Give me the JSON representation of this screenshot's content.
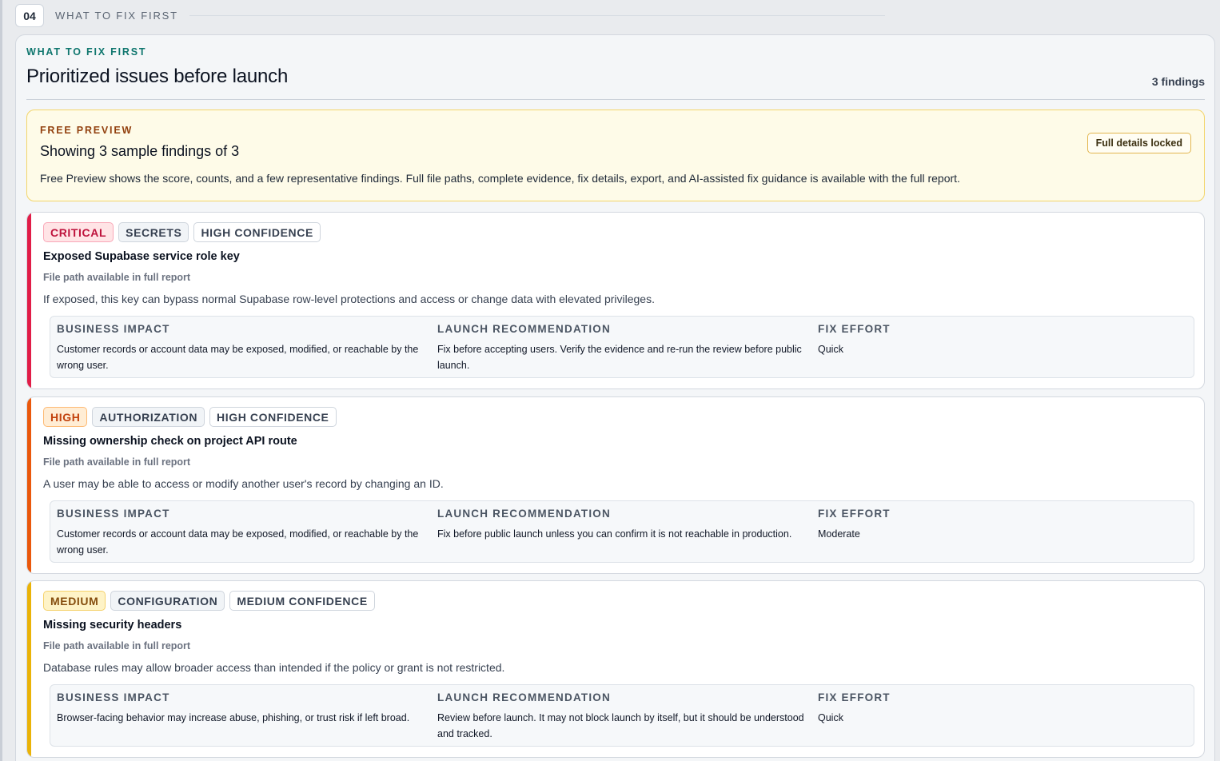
{
  "section": {
    "number": "04",
    "label": "WHAT TO FIX FIRST"
  },
  "panel": {
    "eyebrow": "WHAT TO FIX FIRST",
    "title": "Prioritized issues before launch",
    "count": "3 findings"
  },
  "preview": {
    "eyebrow": "FREE PREVIEW",
    "title": "Showing 3 sample findings of 3",
    "description": "Free Preview shows the score, counts, and a few representative findings. Full file paths, complete evidence, fix details, export, and AI-assisted fix guidance is available with the full report.",
    "locked_label": "Full details locked"
  },
  "labels": {
    "business_impact": "BUSINESS IMPACT",
    "launch_recommendation": "LAUNCH RECOMMENDATION",
    "fix_effort": "FIX EFFORT"
  },
  "colors": {
    "critical": "#e11d48",
    "high": "#ea580c",
    "medium": "#eab308",
    "accent": "#0f766e"
  },
  "findings": [
    {
      "severity": "CRITICAL",
      "category": "SECRETS",
      "confidence": "HIGH CONFIDENCE",
      "title": "Exposed Supabase service role key",
      "path": "File path available in full report",
      "description": "If exposed, this key can bypass normal Supabase row-level protections and access or change data with elevated privileges.",
      "business_impact": "Customer records or account data may be exposed, modified, or reachable by the wrong user.",
      "launch_recommendation": "Fix before accepting users. Verify the evidence and re-run the review before public launch.",
      "fix_effort": "Quick"
    },
    {
      "severity": "HIGH",
      "category": "AUTHORIZATION",
      "confidence": "HIGH CONFIDENCE",
      "title": "Missing ownership check on project API route",
      "path": "File path available in full report",
      "description": "A user may be able to access or modify another user's record by changing an ID.",
      "business_impact": "Customer records or account data may be exposed, modified, or reachable by the wrong user.",
      "launch_recommendation": "Fix before public launch unless you can confirm it is not reachable in production.",
      "fix_effort": "Moderate"
    },
    {
      "severity": "MEDIUM",
      "category": "CONFIGURATION",
      "confidence": "MEDIUM CONFIDENCE",
      "title": "Missing security headers",
      "path": "File path available in full report",
      "description": "Database rules may allow broader access than intended if the policy or grant is not restricted.",
      "business_impact": "Browser-facing behavior may increase abuse, phishing, or trust risk if left broad.",
      "launch_recommendation": "Review before launch. It may not block launch by itself, but it should be understood and tracked.",
      "fix_effort": "Quick"
    }
  ]
}
